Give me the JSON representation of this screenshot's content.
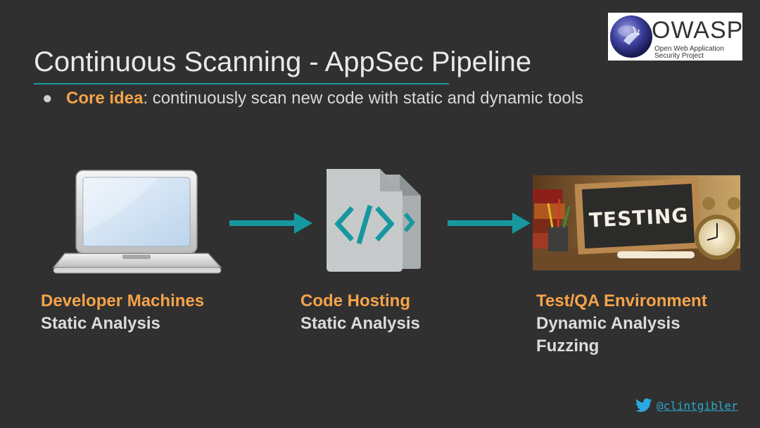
{
  "title": "Continuous Scanning - AppSec Pipeline",
  "bullet": {
    "marker": "●",
    "highlight": "Core idea",
    "text": ": continuously scan new code with static and dynamic tools"
  },
  "logo": {
    "name": "OWASP",
    "tagline_1": "Open Web Application",
    "tagline_2": "Security Project"
  },
  "stages": [
    {
      "title": "Developer Machines",
      "lines": [
        "Static Analysis"
      ],
      "icon": "laptop-icon"
    },
    {
      "title": "Code Hosting",
      "lines": [
        "Static Analysis"
      ],
      "icon": "code-file-icon"
    },
    {
      "title": "Test/QA Environment",
      "lines": [
        "Dynamic Analysis",
        "Fuzzing"
      ],
      "icon": "testing-chalkboard-image",
      "board_text": "TESTING"
    }
  ],
  "twitter": {
    "handle": "@clintgibler",
    "icon": "twitter-bird-icon"
  },
  "colors": {
    "background": "#303030",
    "accent_orange": "#f5a34a",
    "arrow_teal": "#17989f",
    "underline_teal": "#1a9aa8"
  }
}
